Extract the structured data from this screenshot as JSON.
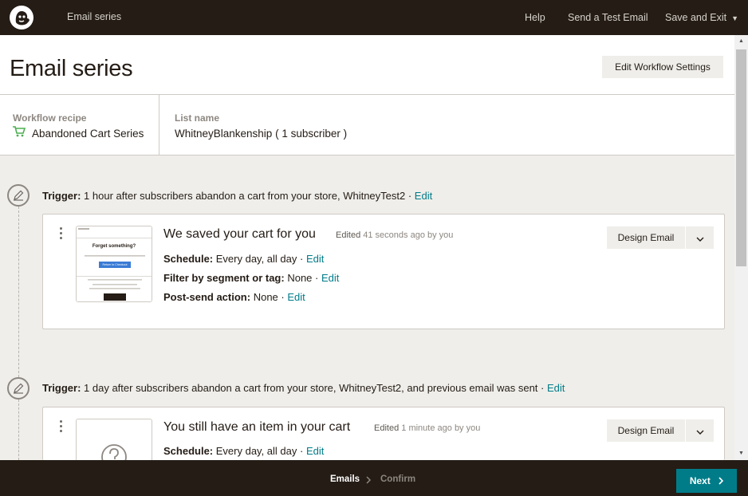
{
  "topbar": {
    "logo_icon": "freddie-chimp-icon",
    "title": "Email series",
    "help": "Help",
    "send_test": "Send a Test Email",
    "save_exit": "Save and Exit"
  },
  "header": {
    "page_title": "Email series",
    "edit_settings": "Edit Workflow Settings",
    "workflow_recipe_label": "Workflow recipe",
    "workflow_recipe_value": "Abandoned Cart Series",
    "list_name_label": "List name",
    "list_name_value": "WhitneyBlankenship ( 1 subscriber )"
  },
  "steps": [
    {
      "trigger_label": "Trigger:",
      "trigger_text": "1 hour after subscribers abandon a cart from your store, WhitneyTest2 ·",
      "trigger_edit": "Edit",
      "email": {
        "subject": "We saved your cart for you",
        "edited_prefix": "Edited",
        "edited_ago": "41 seconds ago",
        "edited_by": "by you",
        "schedule_label": "Schedule:",
        "schedule_value": "Every day, all day ·",
        "filter_label": "Filter by segment or tag:",
        "filter_value": "None ·",
        "postsend_label": "Post-send action:",
        "postsend_value": "None ·",
        "edit": "Edit",
        "design_button": "Design Email",
        "thumb_heading": "Forget something?",
        "thumb_cta": "Return to Checkout"
      }
    },
    {
      "trigger_label": "Trigger:",
      "trigger_text": "1 day after subscribers abandon a cart from your store, WhitneyTest2, and previous email was sent ·",
      "trigger_edit": "Edit",
      "email": {
        "subject": "You still have an item in your cart",
        "edited_prefix": "Edited",
        "edited_ago": "1 minute ago",
        "edited_by": "by you",
        "schedule_label": "Schedule:",
        "schedule_value": "Every day, all day ·",
        "edit": "Edit",
        "design_button": "Design Email"
      }
    }
  ],
  "footer": {
    "crumb_emails": "Emails",
    "crumb_confirm": "Confirm",
    "next_button": "Next"
  },
  "colors": {
    "dark": "#241c15",
    "link": "#007c89",
    "background": "#efeeea",
    "cart_green": "#4caf50"
  }
}
